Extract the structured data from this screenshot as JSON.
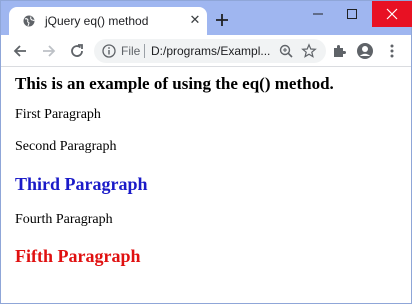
{
  "browser": {
    "tab_title": "jQuery eq() method",
    "tab_close": "✕",
    "address_scheme": "File",
    "address_url": "D:/programs/Exampl...",
    "accent_colors": {
      "titlebar": "#9fb6f0",
      "close_button": "#e81123"
    },
    "icons": [
      "globe-icon",
      "close-icon",
      "new-tab-icon",
      "minimize-icon",
      "maximize-icon",
      "window-close-icon",
      "back-icon",
      "forward-icon",
      "reload-icon",
      "info-icon",
      "zoom-icon",
      "star-icon",
      "extensions-icon",
      "profile-icon",
      "menu-icon"
    ]
  },
  "page": {
    "heading": "This is an example of using the eq() method.",
    "paragraphs": [
      {
        "text": "First Paragraph",
        "color": "#000000"
      },
      {
        "text": "Second Paragraph",
        "color": "#000000"
      },
      {
        "text": "Third Paragraph",
        "color": "#1a1ac8"
      },
      {
        "text": "Fourth Paragraph",
        "color": "#000000"
      },
      {
        "text": "Fifth Paragraph",
        "color": "#e01010"
      }
    ]
  }
}
